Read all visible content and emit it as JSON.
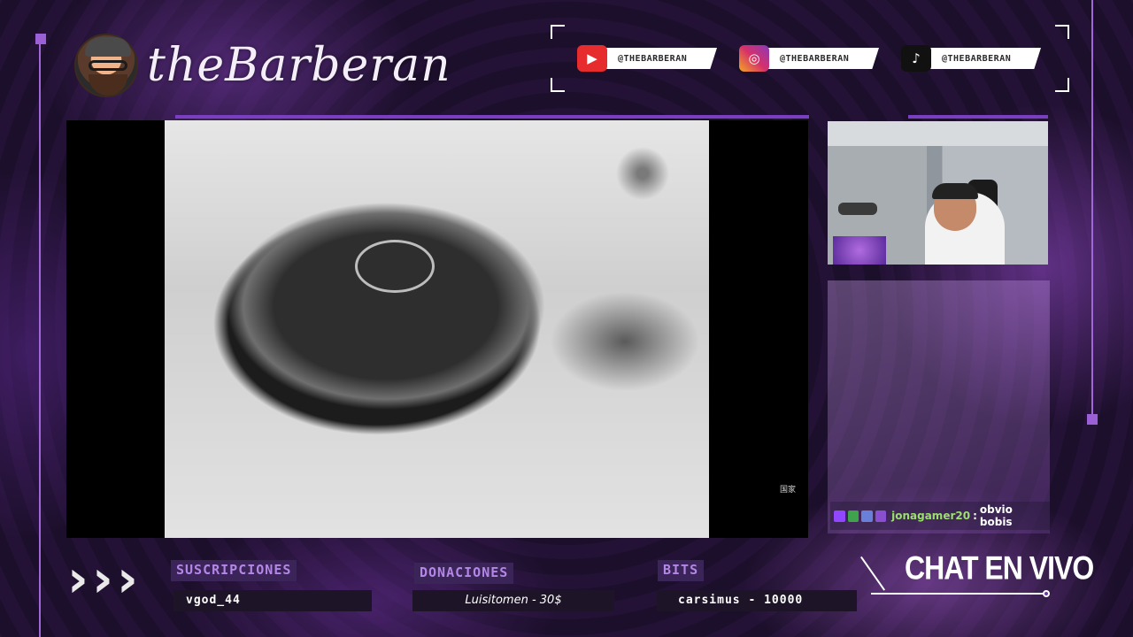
{
  "brand": {
    "name": "theBarberan"
  },
  "socials": [
    {
      "platform": "youtube",
      "icon": "youtube-icon",
      "color": "#e62c2c",
      "handle": "@THEBARBERAN"
    },
    {
      "platform": "instagram",
      "icon": "instagram-icon",
      "color": "#d6316a",
      "handle": "@THEBARBERAN"
    },
    {
      "platform": "tiktok",
      "icon": "tiktok-icon",
      "color": "#111111",
      "handle": "@THEBARBERAN"
    }
  ],
  "screen": {
    "watermark": "国家"
  },
  "chat": {
    "messages": [
      {
        "user": "jonagamer20",
        "separator": " :",
        "text": " obvio bobis"
      }
    ]
  },
  "stats": {
    "subs_label": "SUSCRIPCIONES",
    "subs_value": "vgod_44",
    "donations_label": "DONACIONES",
    "donations_value": "Luisitomen - 30$",
    "bits_label": "BITS",
    "bits_value": "carsimus - 10000"
  },
  "chat_live_label": "CHAT EN VIVO",
  "colors": {
    "accent": "#7a3fc0",
    "label_text": "#b486e6",
    "chat_user": "#9ae06a"
  }
}
